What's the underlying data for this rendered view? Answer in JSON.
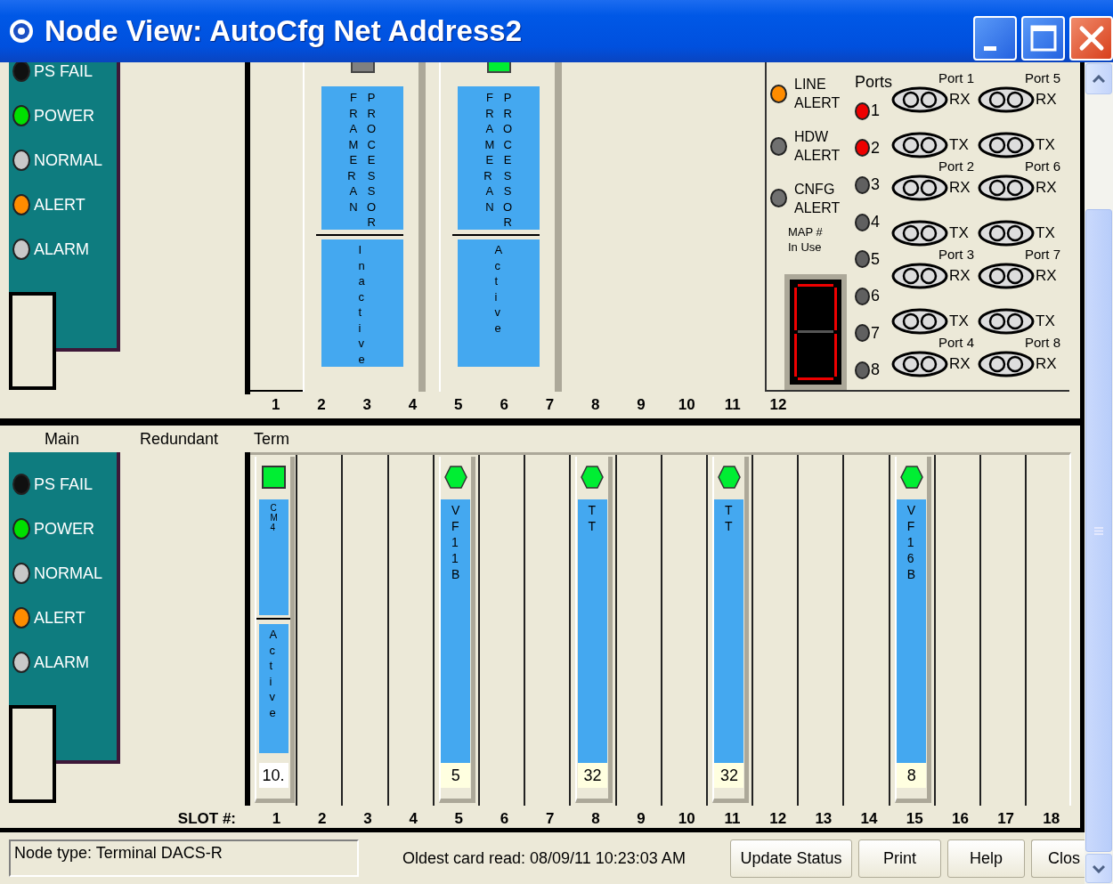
{
  "window": {
    "title": "Node View: AutoCfg Net Address2"
  },
  "upper_shelf": {
    "status_panel": {
      "leds": [
        {
          "label": "PS FAIL",
          "color": "#101010"
        },
        {
          "label": "POWER",
          "color": "#00e000"
        },
        {
          "label": "NORMAL",
          "color": "#c8c8c8"
        },
        {
          "label": "ALERT",
          "color": "#ff8c00"
        },
        {
          "label": "ALARM",
          "color": "#c8c8c8"
        }
      ]
    },
    "cards": [
      {
        "indicator": {
          "kind": "square",
          "color": "#808080"
        },
        "label_columns": [
          "FRAMER AN",
          "PROCESSOR"
        ],
        "status": "Inactive"
      },
      {
        "indicator": {
          "kind": "square",
          "color": "#00ee33"
        },
        "label_columns": [
          "FRAMER AN",
          "PROCESSOR"
        ],
        "status": "Active"
      }
    ],
    "line_module": {
      "alerts": [
        {
          "label": "LINE\nALERT",
          "color": "#ff8c00"
        },
        {
          "label": "HDW\nALERT",
          "color": "#707070"
        },
        {
          "label": "CNFG\nALERT",
          "color": "#707070"
        }
      ],
      "map_label": "MAP #\nIn Use",
      "ports_heading": "Ports",
      "port_leds": [
        {
          "label": "1",
          "color": "#ee0000"
        },
        {
          "label": "2",
          "color": "#ee0000"
        },
        {
          "label": "3",
          "color": "#606060"
        },
        {
          "label": "4",
          "color": "#606060"
        },
        {
          "label": "5",
          "color": "#606060"
        },
        {
          "label": "6",
          "color": "#606060"
        },
        {
          "label": "7",
          "color": "#606060"
        },
        {
          "label": "8",
          "color": "#606060"
        }
      ],
      "ports": [
        {
          "name": "Port 1",
          "rx": "RX"
        },
        {
          "tx": "TX",
          "name": "Port 2",
          "rx": "RX"
        },
        {
          "tx": "TX",
          "name": "Port 3",
          "rx": "RX"
        },
        {
          "tx": "TX",
          "name": "Port 4",
          "rx": "RX"
        },
        {
          "name": "Port 5",
          "rx": "RX"
        },
        {
          "tx": "TX",
          "name": "Port 6",
          "rx": "RX"
        },
        {
          "tx": "TX",
          "name": "Port 7",
          "rx": "RX"
        },
        {
          "tx": "TX",
          "name": "Port 8",
          "rx": "RX"
        }
      ]
    },
    "slot_numbers": [
      "1",
      "2",
      "3",
      "4",
      "5",
      "6",
      "7",
      "8",
      "9",
      "10",
      "11",
      "12"
    ]
  },
  "lower_shelf": {
    "headers": [
      "Main",
      "Redundant",
      "Term"
    ],
    "status_panel": {
      "leds": [
        {
          "label": "PS FAIL",
          "color": "#101010"
        },
        {
          "label": "POWER",
          "color": "#00e000"
        },
        {
          "label": "NORMAL",
          "color": "#c8c8c8"
        },
        {
          "label": "ALERT",
          "color": "#ff8c00"
        },
        {
          "label": "ALARM",
          "color": "#c8c8c8"
        }
      ]
    },
    "slot_label": "SLOT #:",
    "slots": [
      {
        "number": "1",
        "card": {
          "kind": "split",
          "indicator": {
            "kind": "square",
            "color": "#00ee33"
          },
          "label": "CM4",
          "status": "Active",
          "value": "10."
        }
      },
      {
        "number": "2"
      },
      {
        "number": "3"
      },
      {
        "number": "4"
      },
      {
        "number": "5",
        "card": {
          "kind": "full",
          "indicator": {
            "kind": "hexagon",
            "color": "#00ee33"
          },
          "label": "VF11B",
          "value": "5"
        }
      },
      {
        "number": "6"
      },
      {
        "number": "7"
      },
      {
        "number": "8",
        "card": {
          "kind": "full",
          "indicator": {
            "kind": "hexagon",
            "color": "#00ee33"
          },
          "label": "TT",
          "value": "32"
        }
      },
      {
        "number": "9"
      },
      {
        "number": "10"
      },
      {
        "number": "11",
        "card": {
          "kind": "full",
          "indicator": {
            "kind": "hexagon",
            "color": "#00ee33"
          },
          "label": "TT",
          "value": "32"
        }
      },
      {
        "number": "12"
      },
      {
        "number": "13"
      },
      {
        "number": "14"
      },
      {
        "number": "15",
        "card": {
          "kind": "full",
          "indicator": {
            "kind": "hexagon",
            "color": "#00ee33"
          },
          "label": "VF16B",
          "value": "8"
        }
      },
      {
        "number": "16"
      },
      {
        "number": "17"
      },
      {
        "number": "18"
      }
    ]
  },
  "status_bar": {
    "node_type": "Node type: Terminal DACS-R",
    "oldest_read": "Oldest card read: 08/09/11 10:23:03 AM",
    "buttons": [
      "Update Status",
      "Print",
      "Help",
      "Clos"
    ]
  }
}
